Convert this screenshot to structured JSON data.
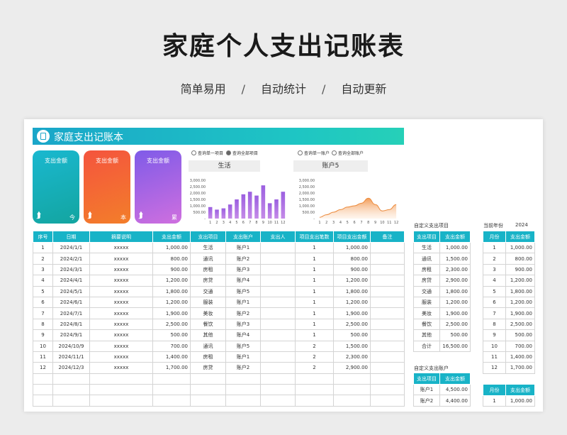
{
  "page": {
    "title": "家庭个人支出记账表",
    "features": [
      "简单易用",
      "自动统计",
      "自动更新"
    ],
    "separator": "/"
  },
  "sheet": {
    "banner_title": "家庭支出记账本",
    "cards": [
      {
        "label": "支出金额",
        "period": "今",
        "color": "#1ab8d0"
      },
      {
        "label": "支出金额",
        "period": "本",
        "color": "#f4543e"
      },
      {
        "label": "支出金额",
        "period": "累",
        "color": "#7f5be8"
      }
    ],
    "filters": {
      "left": [
        "查询单一项目",
        "查询全部项目"
      ],
      "right": [
        "查询单一账户",
        "查询全部账户"
      ]
    },
    "chart_labels": {
      "left": "生活",
      "right": "账户5"
    },
    "icons": {
      "banner": "document-icon",
      "card_arrow": "arrow-up-icon",
      "radio": "radio-icon"
    }
  },
  "chart_data": [
    {
      "type": "bar",
      "title": "生活",
      "categories": [
        "1",
        "2",
        "3",
        "4",
        "5",
        "6",
        "7",
        "8",
        "9",
        "10",
        "11",
        "12"
      ],
      "values": [
        900,
        700,
        800,
        1100,
        1500,
        1900,
        2100,
        1800,
        2600,
        1200,
        1500,
        2100
      ],
      "y_ticks": [
        "3,000.00",
        "2,500.00",
        "2,000.00",
        "1,500.00",
        "1,000.00",
        "500.00",
        "-"
      ],
      "ylim": [
        0,
        3000
      ],
      "color": "#8e5fde"
    },
    {
      "type": "area",
      "title": "账户5",
      "categories": [
        "1",
        "2",
        "3",
        "4",
        "5",
        "6",
        "7",
        "8",
        "9",
        "10",
        "11",
        "12"
      ],
      "values": [
        100,
        300,
        500,
        700,
        900,
        1000,
        1200,
        1600,
        1100,
        600,
        700,
        1100
      ],
      "y_ticks": [
        "3,000.00",
        "2,500.00",
        "2,000.00",
        "1,500.00",
        "1,000.00",
        "500.00",
        "-"
      ],
      "ylim": [
        0,
        3000
      ],
      "color": "#f29a55"
    }
  ],
  "main_table": {
    "headers": [
      "序号",
      "日期",
      "摘要说明",
      "支出金额",
      "支出项目",
      "支出账户",
      "支出人",
      "项目支出笔数",
      "项目支出金额",
      "备注"
    ],
    "rows": [
      [
        "1",
        "2024/1/1",
        "xxxxx",
        "1,000.00",
        "生活",
        "账户1",
        "",
        "1",
        "1,000.00",
        ""
      ],
      [
        "2",
        "2024/2/1",
        "xxxxx",
        "800.00",
        "通讯",
        "账户2",
        "",
        "1",
        "800.00",
        ""
      ],
      [
        "3",
        "2024/3/1",
        "xxxxx",
        "900.00",
        "房租",
        "账户3",
        "",
        "1",
        "900.00",
        ""
      ],
      [
        "4",
        "2024/4/1",
        "xxxxx",
        "1,200.00",
        "房贷",
        "账户4",
        "",
        "1",
        "1,200.00",
        ""
      ],
      [
        "5",
        "2024/5/1",
        "xxxxx",
        "1,800.00",
        "交通",
        "账户5",
        "",
        "1",
        "1,800.00",
        ""
      ],
      [
        "6",
        "2024/6/1",
        "xxxxx",
        "1,200.00",
        "服装",
        "账户1",
        "",
        "1",
        "1,200.00",
        ""
      ],
      [
        "7",
        "2024/7/1",
        "xxxxx",
        "1,900.00",
        "美妆",
        "账户2",
        "",
        "1",
        "1,900.00",
        ""
      ],
      [
        "8",
        "2024/8/1",
        "xxxxx",
        "2,500.00",
        "餐饮",
        "账户3",
        "",
        "1",
        "2,500.00",
        ""
      ],
      [
        "9",
        "2024/9/1",
        "xxxxx",
        "500.00",
        "其他",
        "账户4",
        "",
        "1",
        "500.00",
        ""
      ],
      [
        "10",
        "2024/10/9",
        "xxxxx",
        "700.00",
        "通讯",
        "账户5",
        "",
        "2",
        "1,500.00",
        ""
      ],
      [
        "11",
        "2024/11/1",
        "xxxxx",
        "1,400.00",
        "房租",
        "账户1",
        "",
        "2",
        "2,300.00",
        ""
      ],
      [
        "12",
        "2024/12/3",
        "xxxxx",
        "1,700.00",
        "房贷",
        "账户2",
        "",
        "2",
        "2,900.00",
        ""
      ],
      [
        "",
        "",
        "",
        "",
        "",
        "",
        "",
        "",
        "",
        ""
      ],
      [
        "",
        "",
        "",
        "",
        "",
        "",
        "",
        "",
        "",
        ""
      ],
      [
        "",
        "",
        "",
        "",
        "",
        "",
        "",
        "",
        "",
        ""
      ]
    ]
  },
  "project_table": {
    "label": "自定义支出项目",
    "headers": [
      "支出项目",
      "支出金额"
    ],
    "rows": [
      [
        "生活",
        "1,000.00"
      ],
      [
        "通讯",
        "1,500.00"
      ],
      [
        "房租",
        "2,300.00"
      ],
      [
        "房贷",
        "2,900.00"
      ],
      [
        "交通",
        "1,800.00"
      ],
      [
        "服装",
        "1,200.00"
      ],
      [
        "美妆",
        "1,900.00"
      ],
      [
        "餐饮",
        "2,500.00"
      ],
      [
        "其他",
        "500.00"
      ],
      [
        "合计",
        "16,500.00"
      ]
    ]
  },
  "account_table": {
    "label": "自定义支出账户",
    "headers": [
      "支出项目",
      "支出金额"
    ],
    "rows": [
      [
        "账户1",
        "4,500.00"
      ],
      [
        "账户2",
        "4,400.00"
      ]
    ]
  },
  "month_table": {
    "label": "当前年份",
    "year": "2024",
    "headers": [
      "月份",
      "支出金额"
    ],
    "rows": [
      [
        "1",
        "1,000.00"
      ],
      [
        "2",
        "800.00"
      ],
      [
        "3",
        "900.00"
      ],
      [
        "4",
        "1,200.00"
      ],
      [
        "5",
        "1,800.00"
      ],
      [
        "6",
        "1,200.00"
      ],
      [
        "7",
        "1,900.00"
      ],
      [
        "8",
        "2,500.00"
      ],
      [
        "9",
        "500.00"
      ],
      [
        "10",
        "700.00"
      ],
      [
        "11",
        "1,400.00"
      ],
      [
        "12",
        "1,700.00"
      ]
    ]
  },
  "month_table2": {
    "headers": [
      "月份",
      "支出金额"
    ],
    "rows": [
      [
        "1",
        "1,000.00"
      ]
    ]
  }
}
